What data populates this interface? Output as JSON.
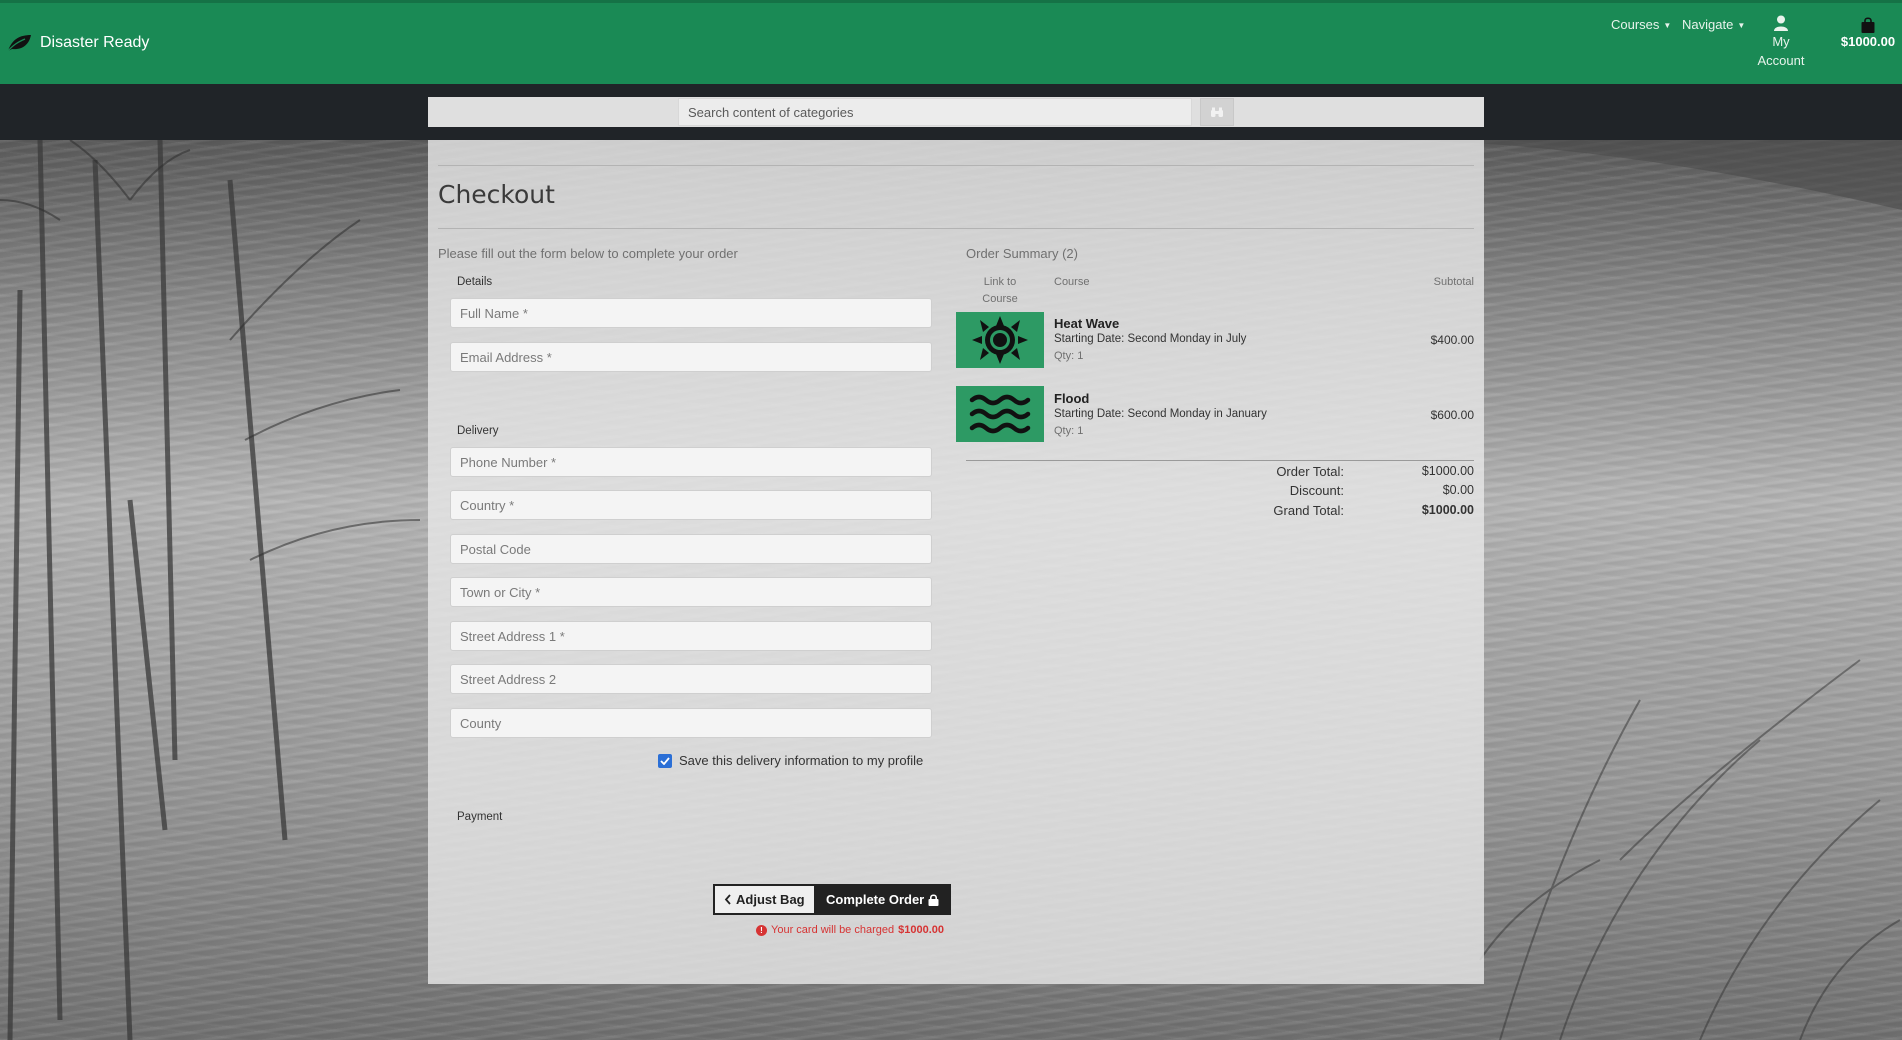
{
  "brand": {
    "name": "Disaster Ready"
  },
  "nav": {
    "courses": "Courses",
    "navigate": "Navigate",
    "account_line1": "My",
    "account_line2": "Account",
    "bag_total": "$1000.00"
  },
  "search": {
    "placeholder": "Search content of categories",
    "button_icon": "binoculars-icon"
  },
  "checkout": {
    "title": "Checkout",
    "intro": "Please fill out the form below to complete your order",
    "details_legend": "Details",
    "delivery_legend": "Delivery",
    "payment_legend": "Payment",
    "fields": {
      "full_name": "Full Name *",
      "email": "Email Address *",
      "phone": "Phone Number *",
      "country": "Country *",
      "postcode": "Postal Code",
      "town": "Town or City *",
      "street1": "Street Address 1 *",
      "street2": "Street Address 2",
      "county": "County"
    },
    "save_info_label": "Save this delivery information to my profile",
    "save_info_checked": true,
    "adjust_bag": "Adjust Bag",
    "complete_order": "Complete Order",
    "charge_text": "Your card will be charged",
    "charge_amount": "$1000.00"
  },
  "summary": {
    "title": "Order Summary (2)",
    "col_link": "Link to Course",
    "col_link_1": "Link to",
    "col_link_2": "Course",
    "col_course": "Course",
    "col_subtotal": "Subtotal",
    "items": [
      {
        "name": "Heat Wave",
        "date": "Starting Date: Second Monday in July",
        "qty": "Qty: 1",
        "subtotal": "$400.00",
        "icon": "sun-icon"
      },
      {
        "name": "Flood",
        "date": "Starting Date: Second Monday in January",
        "qty": "Qty: 1",
        "subtotal": "$600.00",
        "icon": "waves-icon"
      }
    ],
    "order_total_label": "Order Total:",
    "order_total": "$1000.00",
    "discount_label": "Discount:",
    "discount": "$0.00",
    "grand_total_label": "Grand Total:",
    "grand_total": "$1000.00"
  },
  "colors": {
    "brand_green": "#1a8a55",
    "dark_bar": "#202428",
    "warning_red": "#d63333"
  }
}
